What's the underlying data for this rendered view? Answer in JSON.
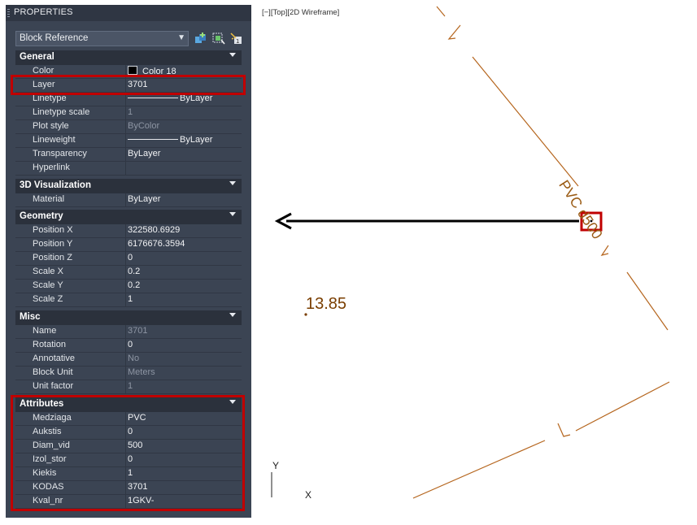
{
  "palette": {
    "title": "PROPERTIES",
    "selector": {
      "value": "Block Reference"
    },
    "tools": [
      "add-selected-icon",
      "quick-select-icon",
      "toggle-pickadd-icon"
    ]
  },
  "sections": {
    "general": {
      "label": "General",
      "rows": [
        {
          "key": "Color",
          "value": "Color 18",
          "swatch": "#000000"
        },
        {
          "key": "Layer",
          "value": "3701"
        },
        {
          "key": "Linetype",
          "value": "ByLayer"
        },
        {
          "key": "Linetype scale",
          "value": "1"
        },
        {
          "key": "Plot style",
          "value": "ByColor"
        },
        {
          "key": "Lineweight",
          "value": "ByLayer"
        },
        {
          "key": "Transparency",
          "value": "ByLayer"
        },
        {
          "key": "Hyperlink",
          "value": ""
        }
      ]
    },
    "viz3d": {
      "label": "3D Visualization",
      "rows": [
        {
          "key": "Material",
          "value": "ByLayer"
        }
      ]
    },
    "geometry": {
      "label": "Geometry",
      "rows": [
        {
          "key": "Position X",
          "value": "322580.6929"
        },
        {
          "key": "Position Y",
          "value": "6176676.3594"
        },
        {
          "key": "Position Z",
          "value": "0"
        },
        {
          "key": "Scale X",
          "value": "0.2"
        },
        {
          "key": "Scale Y",
          "value": "0.2"
        },
        {
          "key": "Scale Z",
          "value": "1"
        }
      ]
    },
    "misc": {
      "label": "Misc",
      "rows": [
        {
          "key": "Name",
          "value": "3701"
        },
        {
          "key": "Rotation",
          "value": "0"
        },
        {
          "key": "Annotative",
          "value": "No"
        },
        {
          "key": "Block Unit",
          "value": "Meters"
        },
        {
          "key": "Unit factor",
          "value": "1"
        }
      ]
    },
    "attributes": {
      "label": "Attributes",
      "rows": [
        {
          "key": "Medziaga",
          "value": "PVC"
        },
        {
          "key": "Aukstis",
          "value": "0"
        },
        {
          "key": "Diam_vid",
          "value": "500"
        },
        {
          "key": "Izol_stor",
          "value": "0"
        },
        {
          "key": "Kiekis",
          "value": "1"
        },
        {
          "key": "KODAS",
          "value": "3701"
        },
        {
          "key": "Kval_nr",
          "value": "1GKV-"
        }
      ]
    }
  },
  "viewport": {
    "label": "[−][Top][2D Wireframe]",
    "spot_elevation": "13.85",
    "pipe_label": "PVC d500",
    "ucs": {
      "y": "Y",
      "x": "X"
    }
  },
  "colors": {
    "palette_bg": "#3b4453",
    "highlight": "#c00000",
    "pipe_line": "#b5651d",
    "pipe_text": "#9a5b14",
    "spot_text": "#7a3e00"
  }
}
